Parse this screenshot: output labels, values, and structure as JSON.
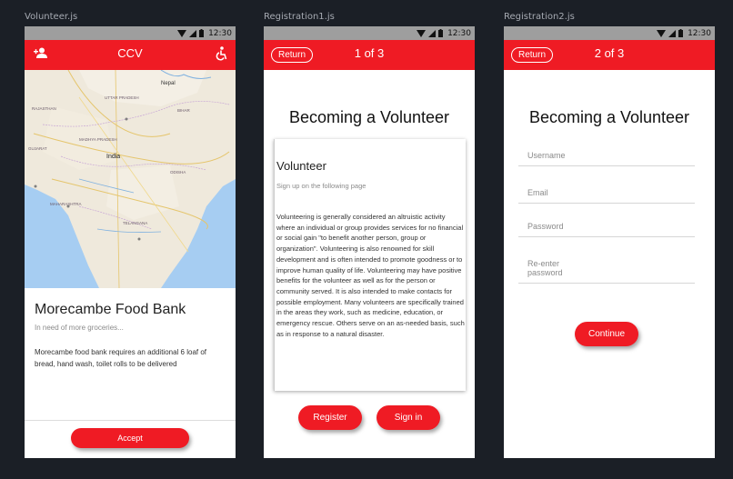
{
  "artboards": [
    {
      "label": "Volunteer.js"
    },
    {
      "label": "Registration1.js"
    },
    {
      "label": "Registration2.js"
    }
  ],
  "status_bar": {
    "time": "12:30"
  },
  "volunteer": {
    "app_title": "CCV",
    "left_icon": "person-add-icon",
    "right_icon": "accessibility-icon",
    "map_labels": {
      "india": "India",
      "nepal": "Nepal",
      "maharashtra": "MAHARASHTRA",
      "telangana": "TELANGANA",
      "rajasthan": "RAJASTHAN",
      "madhya": "MADHYA PRADESH",
      "gujarat": "GUJARAT",
      "odisha": "ODISHA",
      "bihar": "BIHAR",
      "up": "UTTAR PRADESH"
    },
    "card": {
      "title": "Morecambe Food Bank",
      "subtitle": "In need of more groceries...",
      "body": "Morecambe food bank requires an additional 6 loaf of bread, hand wash, toilet rolls to be delivered"
    },
    "accept_label": "Accept"
  },
  "registration1": {
    "return_label": "Return",
    "pager": "1 of 3",
    "heading": "Becoming a Volunteer",
    "info": {
      "title": "Volunteer",
      "subtitle": "Sign up on the following page",
      "body": "Volunteering is generally considered an altruistic activity where an individual or group provides services for no financial or social gain \"to benefit another person, group or organization\". Volunteering is also renowned for skill development and is often intended to promote goodness or to improve human quality of life. Volunteering may have positive benefits for the volunteer as well as for the person or community served. It is also intended to make contacts for possible employment. Many volunteers are specifically trained in the areas they work, such as medicine, education, or emergency rescue. Others serve on an as-needed basis, such as in response to a natural disaster."
    },
    "register_label": "Register",
    "signin_label": "Sign in"
  },
  "registration2": {
    "return_label": "Return",
    "pager": "2 of 3",
    "heading": "Becoming a Volunteer",
    "fields": {
      "username": "Username",
      "email": "Email",
      "password": "Password",
      "reenter": "Re-enter\npassword"
    },
    "continue_label": "Continue"
  },
  "colors": {
    "accent": "#ef1b24",
    "status_bar": "#9e9e9e",
    "background": "#1b1f26"
  }
}
